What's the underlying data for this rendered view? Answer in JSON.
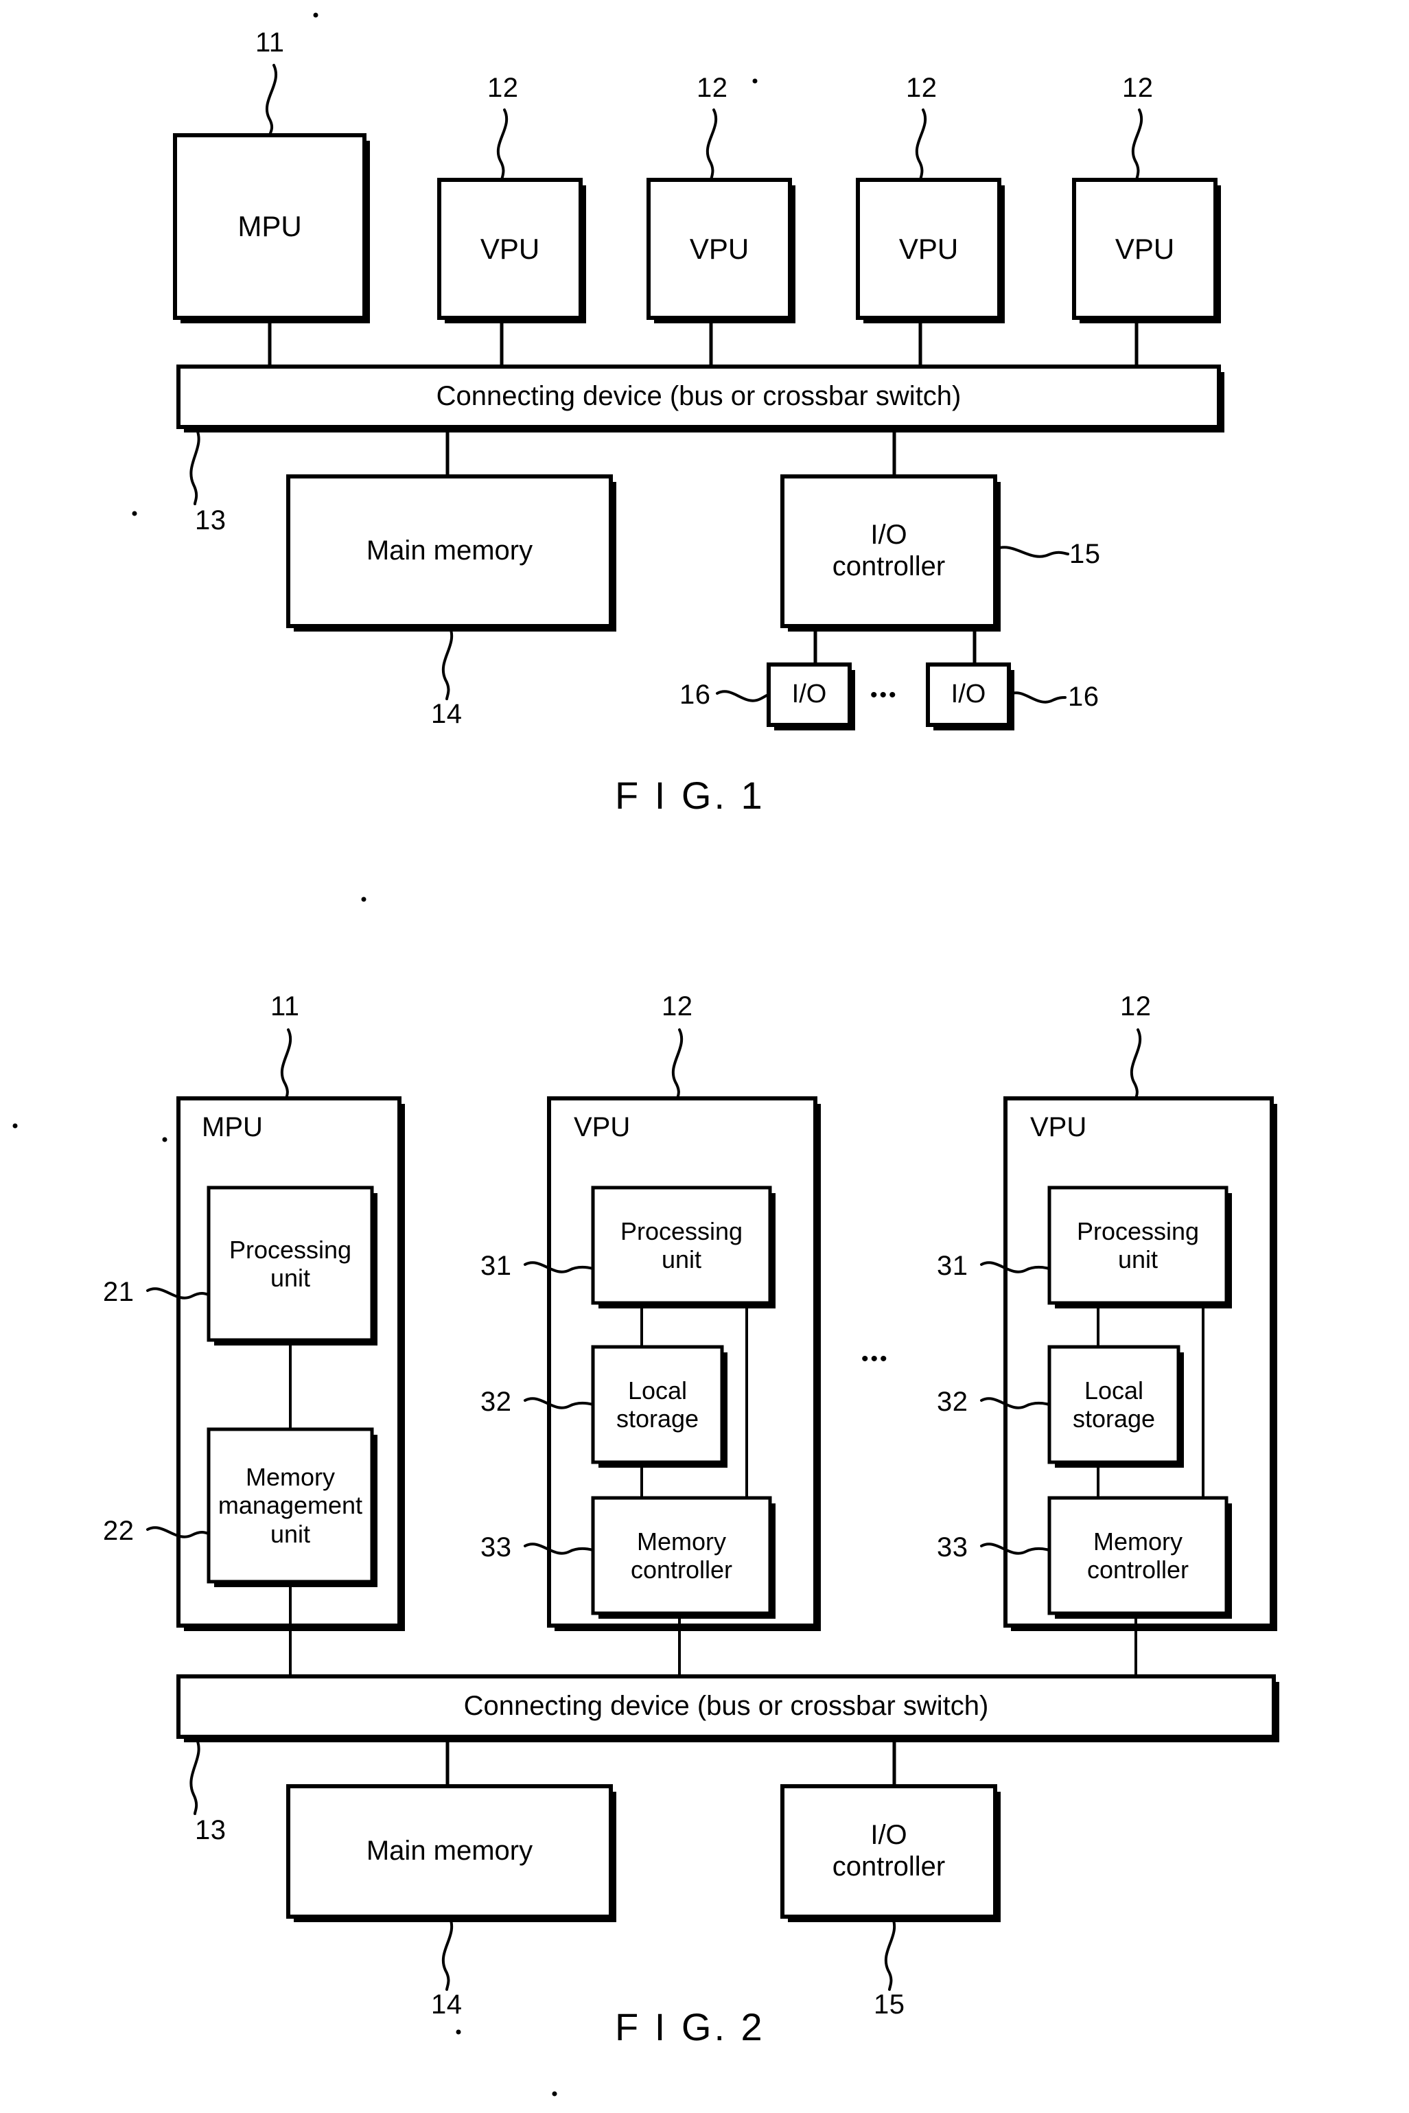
{
  "document": {
    "type": "patent-drawing-sheet",
    "figures": [
      {
        "id": "fig1",
        "caption": "F I G. 1",
        "processors": [
          {
            "label": "MPU",
            "ref": "11"
          },
          {
            "label": "VPU",
            "ref": "12"
          },
          {
            "label": "VPU",
            "ref": "12"
          },
          {
            "label": "VPU",
            "ref": "12"
          },
          {
            "label": "VPU",
            "ref": "12"
          }
        ],
        "bus": {
          "label": "Connecting device (bus or crossbar switch)",
          "ref": "13"
        },
        "memory": {
          "label": "Main memory",
          "ref": "14"
        },
        "io_controller": {
          "label": "I/O\ncontroller",
          "line1": "I/O",
          "line2": "controller",
          "ref": "15"
        },
        "io_devices": [
          {
            "label": "I/O",
            "ref": "16"
          },
          {
            "label": "I/O",
            "ref": "16"
          }
        ],
        "io_ellipsis": "•••"
      },
      {
        "id": "fig2",
        "caption": "F I G. 2",
        "units": [
          {
            "title": "MPU",
            "ref": "11",
            "children": [
              {
                "line1": "Processing",
                "line2": "unit",
                "ref": "21"
              },
              {
                "line1": "Memory",
                "line2": "management",
                "line3": "unit",
                "ref": "22"
              }
            ]
          },
          {
            "title": "VPU",
            "ref": "12",
            "children": [
              {
                "line1": "Processing",
                "line2": "unit",
                "ref": "31"
              },
              {
                "line1": "Local",
                "line2": "storage",
                "ref": "32"
              },
              {
                "line1": "Memory",
                "line2": "controller",
                "ref": "33"
              }
            ]
          },
          {
            "title": "VPU",
            "ref": "12",
            "children": [
              {
                "line1": "Processing",
                "line2": "unit",
                "ref": "31"
              },
              {
                "line1": "Local",
                "line2": "storage",
                "ref": "32"
              },
              {
                "line1": "Memory",
                "line2": "controller",
                "ref": "33"
              }
            ]
          }
        ],
        "unit_ellipsis": "•••",
        "bus": {
          "label": "Connecting device (bus or crossbar switch)",
          "ref": "13"
        },
        "memory": {
          "label": "Main memory",
          "ref": "14"
        },
        "io_controller": {
          "line1": "I/O",
          "line2": "controller",
          "ref": "15"
        }
      }
    ],
    "colors": {
      "ink": "#000000",
      "paper": "#ffffff"
    }
  }
}
